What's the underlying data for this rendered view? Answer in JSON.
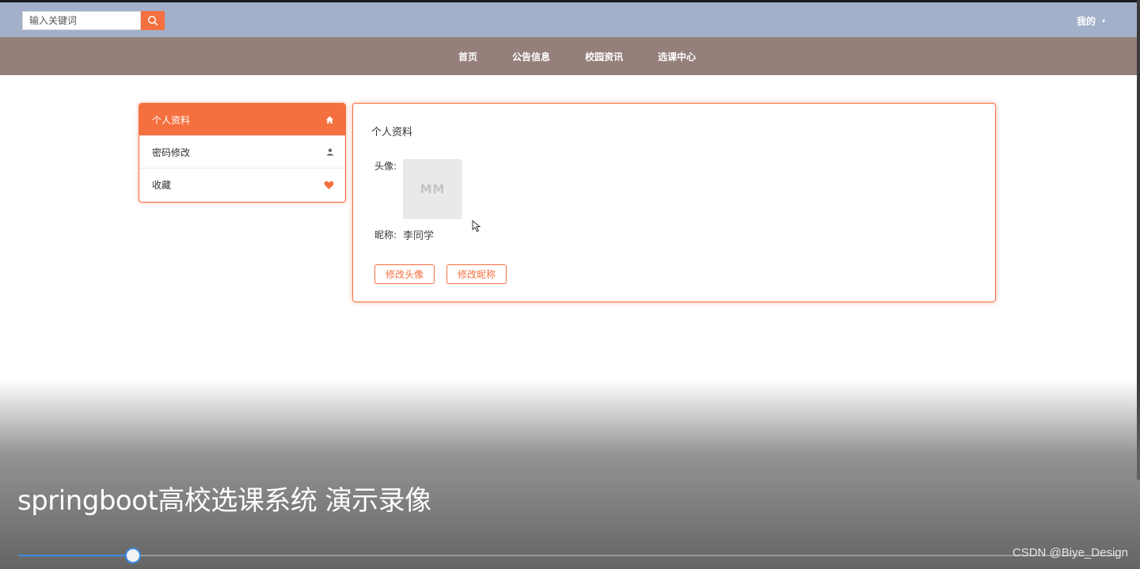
{
  "header": {
    "search_placeholder": "输入关键词",
    "search_icon": "search-icon",
    "user_menu": "我的",
    "accent_color": "#f5703f",
    "topbar_color": "#a2b0c9"
  },
  "nav": {
    "items": [
      "首页",
      "公告信息",
      "校园资讯",
      "选课中心"
    ],
    "background": "#957f7b"
  },
  "sidebar": {
    "items": [
      {
        "label": "个人资料",
        "icon": "home-icon",
        "active": true
      },
      {
        "label": "密码修改",
        "icon": "user-icon",
        "active": false
      },
      {
        "label": "收藏",
        "icon": "heart-icon",
        "active": false
      }
    ]
  },
  "profile": {
    "title": "个人资料",
    "avatar_label": "头像:",
    "avatar_placeholder": "MM",
    "nickname_label": "昵称:",
    "nickname_value": "李同学",
    "change_avatar_button": "修改头像",
    "change_nickname_button": "修改昵称"
  },
  "video": {
    "caption": "springboot高校选课系统 演示录像",
    "progress": 0.103,
    "watermark": "CSDN @Biye_Design"
  }
}
